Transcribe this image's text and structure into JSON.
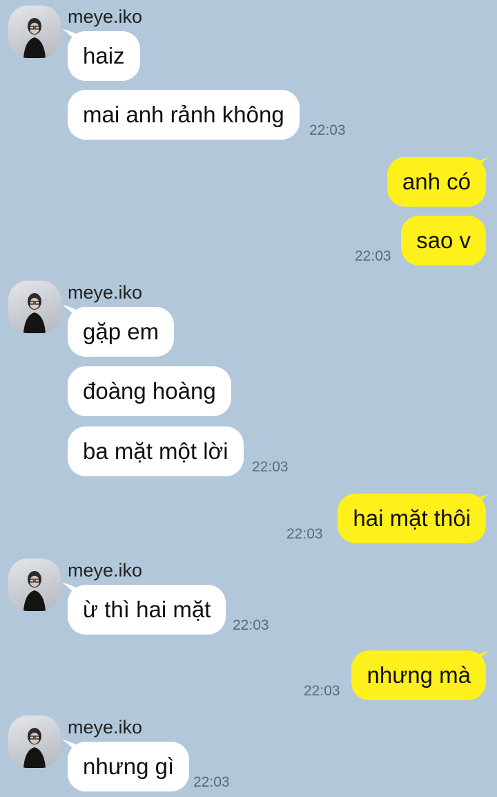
{
  "chat": {
    "messages": [
      {
        "sender": "meye.iko",
        "text": "haiz"
      },
      {
        "sender": "meye.iko",
        "text": "mai anh rảnh không",
        "time": "22:03"
      },
      {
        "sender": "me",
        "text": "anh có"
      },
      {
        "sender": "me",
        "text": "sao v",
        "time": "22:03"
      },
      {
        "sender": "meye.iko",
        "text": "gặp em"
      },
      {
        "sender": "meye.iko",
        "text": "đoàng hoàng"
      },
      {
        "sender": "meye.iko",
        "text": "ba mặt một lời",
        "time": "22:03"
      },
      {
        "sender": "me",
        "text": "hai mặt thôi",
        "time": "22:03"
      },
      {
        "sender": "meye.iko",
        "text": "ừ thì hai mặt",
        "time": "22:03"
      },
      {
        "sender": "me",
        "text": "nhưng mà",
        "time": "22:03"
      },
      {
        "sender": "meye.iko",
        "text": "nhưng gì",
        "time": "22:03"
      }
    ]
  },
  "colors": {
    "background": "#b2c7da",
    "incoming_bubble": "#ffffff",
    "outgoing_bubble": "#fef01b"
  }
}
